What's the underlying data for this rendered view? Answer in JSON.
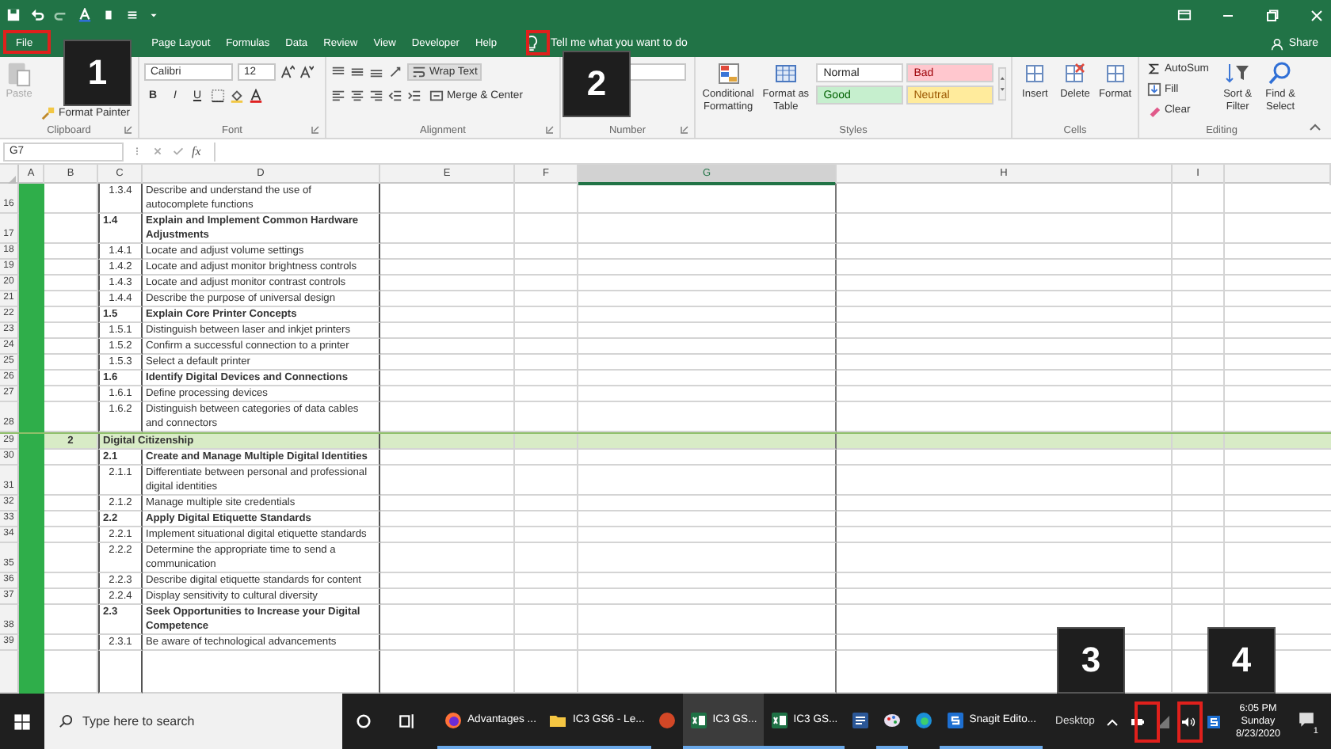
{
  "tabs": [
    {
      "label": "File",
      "selected": false
    },
    {
      "label": "Page Layout",
      "selected": false
    },
    {
      "label": "Formulas",
      "selected": false
    },
    {
      "label": "Data",
      "selected": false
    },
    {
      "label": "Review",
      "selected": false
    },
    {
      "label": "View",
      "selected": false
    },
    {
      "label": "Developer",
      "selected": false
    },
    {
      "label": "Help",
      "selected": false
    }
  ],
  "tell_me": "Tell me what you want to do",
  "share": "Share",
  "ribbon": {
    "paste": "Paste",
    "paste_disabled": true,
    "format_painter": "Format Painter",
    "clipboard_label": "Clipboard",
    "font_name": "Calibri",
    "font_size": "12",
    "bold": "B",
    "italic": "I",
    "underline": "U",
    "font_label": "Font",
    "wrap_text": "Wrap Text",
    "merge": "Merge & Center",
    "alignment_label": "Alignment",
    "number_label": "Number",
    "conditional": "Conditional Formatting",
    "format_table": "Format as Table",
    "cell_styles": [
      {
        "label": "Normal",
        "color": "#ffffff"
      },
      {
        "label": "Bad",
        "color": "#ffc7ce"
      },
      {
        "label": "Good",
        "color": "#c6efce"
      },
      {
        "label": "Neutral",
        "color": "#ffeb9c"
      }
    ],
    "styles_label": "Styles",
    "cell_buttons": [
      "Insert",
      "Delete",
      "Format"
    ],
    "cells_label": "Cells",
    "autosum": "AutoSum",
    "fill": "Fill",
    "clear": "Clear",
    "sort": "Sort & Filter",
    "find": "Find & Select",
    "editing_label": "Editing"
  },
  "formula_bar": {
    "name_box": "G7",
    "function_label": "fx"
  },
  "sheet": {
    "columns": [
      {
        "label": "A",
        "selected": false
      },
      {
        "label": "B",
        "selected": false
      },
      {
        "label": "C",
        "selected": false
      },
      {
        "label": "D",
        "selected": false
      },
      {
        "label": "E",
        "selected": false
      },
      {
        "label": "F",
        "selected": false
      },
      {
        "label": "G",
        "selected": true
      },
      {
        "label": "H",
        "selected": false
      },
      {
        "label": "I",
        "selected": false
      }
    ],
    "rows": [
      {
        "number": "16",
        "kind": "item",
        "code": "1.3.4",
        "text": "Describe and understand the use of autocomplete functions"
      },
      {
        "number": "17",
        "kind": "section",
        "code": "1.4",
        "text": "Explain and Implement Common Hardware Adjustments"
      },
      {
        "number": "18",
        "kind": "item",
        "code": "1.4.1",
        "text": "Locate and adjust volume settings"
      },
      {
        "number": "19",
        "kind": "item",
        "code": "1.4.2",
        "text": "Locate and adjust monitor brightness controls"
      },
      {
        "number": "20",
        "kind": "item",
        "code": "1.4.3",
        "text": "Locate and adjust monitor contrast controls"
      },
      {
        "number": "21",
        "kind": "item",
        "code": "1.4.4",
        "text": "Describe the purpose of universal design"
      },
      {
        "number": "22",
        "kind": "section",
        "code": "1.5",
        "text": "Explain Core Printer Concepts"
      },
      {
        "number": "23",
        "kind": "item",
        "code": "1.5.1",
        "text": "Distinguish between laser and inkjet printers"
      },
      {
        "number": "24",
        "kind": "item",
        "code": "1.5.2",
        "text": "Confirm a successful connection to a printer"
      },
      {
        "number": "25",
        "kind": "item",
        "code": "1.5.3",
        "text": "Select a default printer"
      },
      {
        "number": "26",
        "kind": "section",
        "code": "1.6",
        "text": "Identify Digital Devices and Connections"
      },
      {
        "number": "27",
        "kind": "item",
        "code": "1.6.1",
        "text": "Define processing devices"
      },
      {
        "number": "28",
        "kind": "item",
        "code": "1.6.2",
        "text": "Distinguish between categories of data cables and connectors"
      },
      {
        "number": "29",
        "kind": "category",
        "code": "2",
        "text": "Digital Citizenship"
      },
      {
        "number": "30",
        "kind": "section",
        "code": "2.1",
        "text": "Create and Manage Multiple Digital Identities"
      },
      {
        "number": "31",
        "kind": "item",
        "code": "2.1.1",
        "text": "Differentiate between personal and professional digital identities"
      },
      {
        "number": "32",
        "kind": "item",
        "code": "2.1.2",
        "text": "Manage multiple site credentials"
      },
      {
        "number": "33",
        "kind": "section",
        "code": "2.2",
        "text": "Apply Digital Etiquette Standards"
      },
      {
        "number": "34",
        "kind": "item",
        "code": "2.2.1",
        "text": "Implement situational digital etiquette standards"
      },
      {
        "number": "35",
        "kind": "item",
        "code": "2.2.2",
        "text": "Determine the appropriate time to send a communication"
      },
      {
        "number": "36",
        "kind": "item",
        "code": "2.2.3",
        "text": "Describe digital etiquette standards for content"
      },
      {
        "number": "37",
        "kind": "item",
        "code": "2.2.4",
        "text": "Display sensitivity to cultural diversity"
      },
      {
        "number": "38",
        "kind": "section",
        "code": "2.3",
        "text": "Seek Opportunities to Increase your Digital Competence"
      },
      {
        "number": "39",
        "kind": "item",
        "code": "2.3.1",
        "text": "Be aware of technological advancements"
      }
    ]
  },
  "taskbar": {
    "search": {
      "placeholder": "Type here to search"
    },
    "apps": [
      {
        "kind": "firefox",
        "label": "Advantages ...",
        "running": true,
        "selected": false
      },
      {
        "kind": "folder",
        "label": "IC3 GS6 - Le...",
        "running": true,
        "selected": false
      },
      {
        "kind": "powerpoint",
        "running": false,
        "selected": false
      },
      {
        "kind": "excel",
        "label": "IC3 GS...",
        "running": true,
        "selected": true
      },
      {
        "kind": "excel",
        "label": "IC3 GS...",
        "running": true,
        "selected": false
      },
      {
        "kind": "word",
        "running": false,
        "selected": false
      },
      {
        "kind": "paint",
        "running": true,
        "selected": false
      },
      {
        "kind": "edge",
        "running": false,
        "selected": false
      },
      {
        "kind": "snagit",
        "label": "Snagit Edito...",
        "running": true,
        "selected": false
      }
    ],
    "toolbar_label": "Desktop",
    "time": "6:05 PM",
    "day": "Sunday",
    "date": "8/23/2020",
    "notifications": "1"
  },
  "callouts": [
    {
      "label": "1"
    },
    {
      "label": "2"
    },
    {
      "label": "3"
    },
    {
      "label": "4"
    }
  ]
}
